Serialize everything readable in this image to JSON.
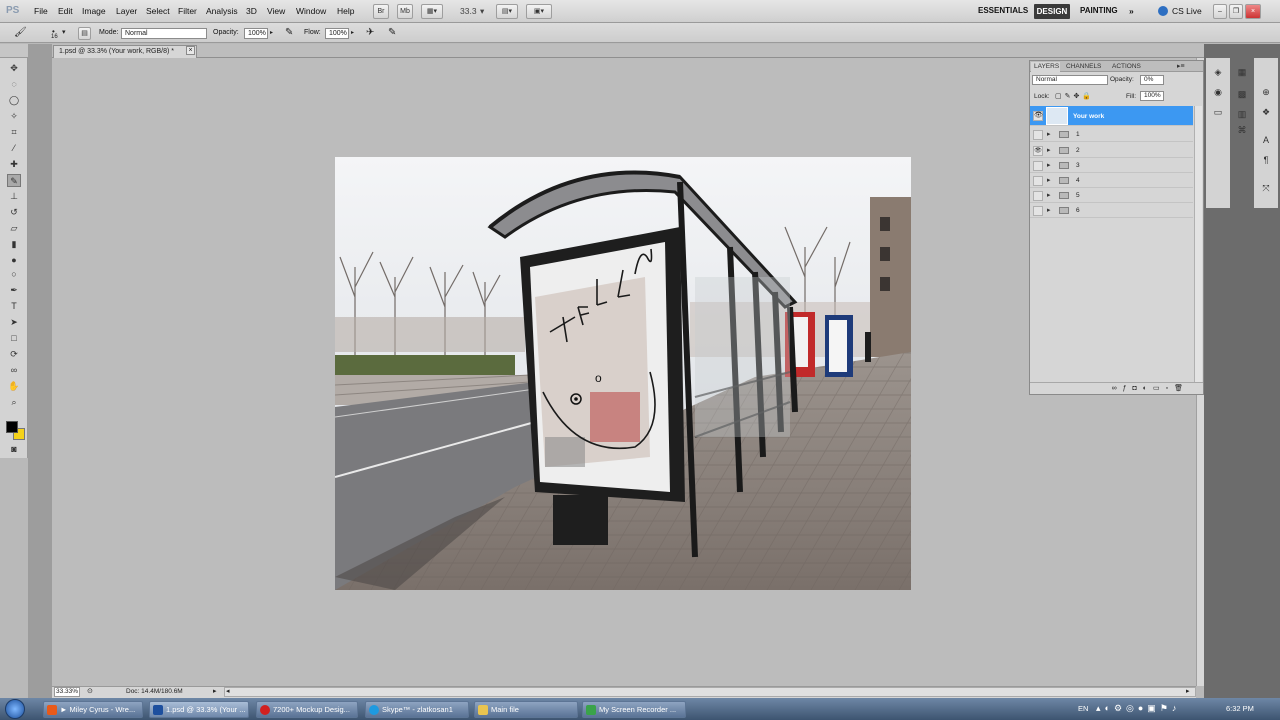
{
  "app": {
    "logo": "PS"
  },
  "menus": [
    "File",
    "Edit",
    "Image",
    "Layer",
    "Select",
    "Filter",
    "Analysis",
    "3D",
    "View",
    "Window",
    "Help"
  ],
  "appbar": {
    "zoom": "33.3"
  },
  "workspaces": {
    "essentials": "ESSENTIALS",
    "design": "DESIGN",
    "painting": "PAINTING",
    "more": "»",
    "cslive": "CS Live"
  },
  "options": {
    "brush_size": "16",
    "mode_label": "Mode:",
    "mode_value": "Normal",
    "opacity_label": "Opacity:",
    "opacity_value": "100%",
    "flow_label": "Flow:",
    "flow_value": "100%"
  },
  "document": {
    "tab_title": "1.psd @ 33.3% (Your work, RGB/8) *",
    "close": "×"
  },
  "layers_panel": {
    "tabs": [
      "LAYERS",
      "CHANNELS",
      "ACTIONS"
    ],
    "blend_mode": "Normal",
    "opacity_label": "Opacity:",
    "opacity_value": "0%",
    "lock_label": "Lock:",
    "fill_label": "Fill:",
    "fill_value": "100%",
    "layers": [
      {
        "name": "Your work",
        "selected": true,
        "visible": true
      },
      {
        "name": "1",
        "visible": false
      },
      {
        "name": "2",
        "visible": true
      },
      {
        "name": "3",
        "visible": false
      },
      {
        "name": "4",
        "visible": false
      },
      {
        "name": "5",
        "visible": false
      },
      {
        "name": "6",
        "visible": false
      }
    ]
  },
  "status": {
    "zoom": "33.33%",
    "doc": "Doc: 14.4M/180.6M"
  },
  "taskbar": {
    "items": [
      {
        "label": "► Miley Cyrus - Wre...",
        "color": "#e85a1a"
      },
      {
        "label": "1.psd @ 33.3% (Your ...",
        "color": "#1d4f9e",
        "active": true
      },
      {
        "label": "7200+ Mockup Desig...",
        "color": "#d12020"
      },
      {
        "label": "Skype™ - zlatkosan1",
        "color": "#1e9ae0"
      },
      {
        "label": "Main file",
        "color": "#e8c450"
      },
      {
        "label": "My Screen Recorder ...",
        "color": "#3aa34a"
      }
    ],
    "lang": "EN",
    "clock": "6:32 PM"
  },
  "artwork": {
    "doodle_text": "HELLO"
  },
  "colors": {
    "accent": "#3399ff",
    "selected_layer": "#3c98f2",
    "foreground": "#000000",
    "background": "#f5d21a"
  }
}
